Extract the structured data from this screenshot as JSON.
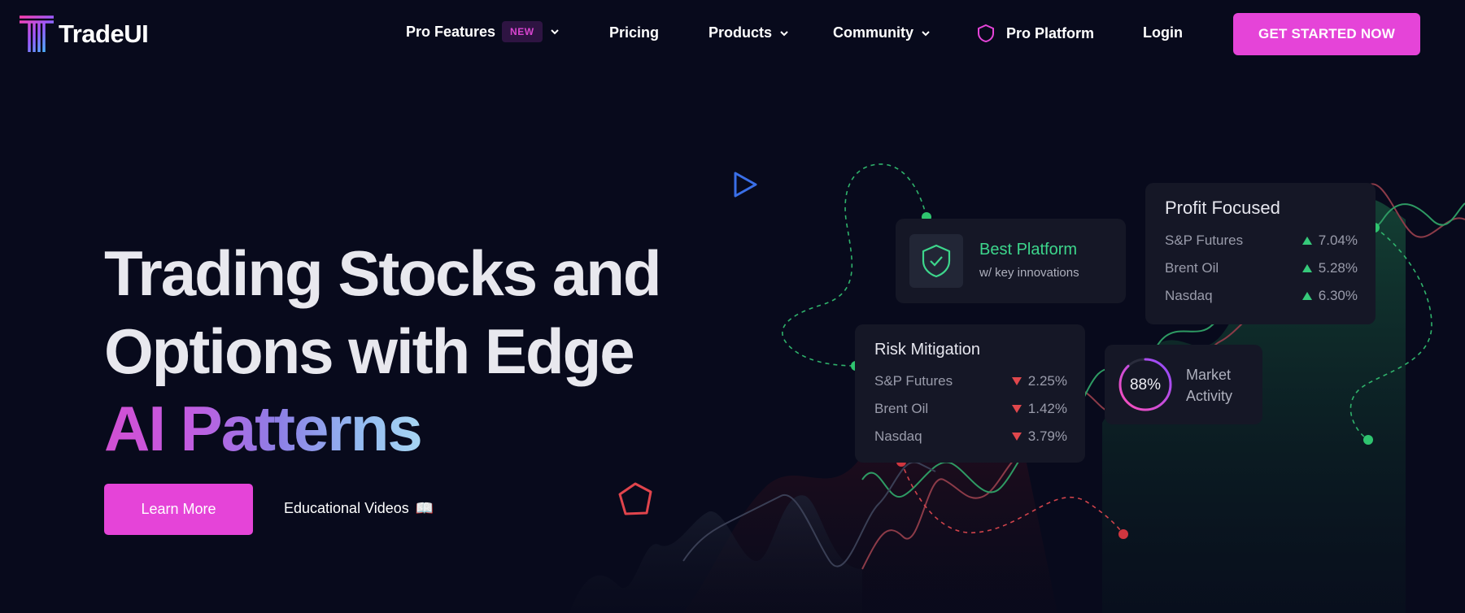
{
  "brand": {
    "name": "TradeUI"
  },
  "nav": {
    "items": [
      {
        "label": "Pro Features",
        "badge": "NEW"
      },
      {
        "label": "Pricing"
      },
      {
        "label": "Products"
      },
      {
        "label": "Community"
      },
      {
        "label": "Pro Platform"
      },
      {
        "label": "Login"
      }
    ],
    "cta": "GET STARTED NOW"
  },
  "hero": {
    "line1": "Trading Stocks and",
    "line2": "Options with Edge",
    "line3": "AI Patterns",
    "primary_button": "Learn More",
    "secondary_link": "Educational Videos",
    "secondary_icon": "📖"
  },
  "cards": {
    "best_platform": {
      "title": "Best Platform",
      "subtitle": "w/ key innovations"
    },
    "profit_focused": {
      "title": "Profit Focused",
      "rows": [
        {
          "name": "S&P Futures",
          "value": "7.04%"
        },
        {
          "name": "Brent Oil",
          "value": "5.28%"
        },
        {
          "name": "Nasdaq",
          "value": "6.30%"
        }
      ]
    },
    "risk_mitigation": {
      "title": "Risk Mitigation",
      "rows": [
        {
          "name": "S&P Futures",
          "value": "2.25%"
        },
        {
          "name": "Brent Oil",
          "value": "1.42%"
        },
        {
          "name": "Nasdaq",
          "value": "3.79%"
        }
      ]
    },
    "market_activity": {
      "percent": "88%",
      "percent_value": 0.88,
      "label_line1": "Market",
      "label_line2": "Activity"
    }
  },
  "colors": {
    "accent": "#e544d8",
    "background": "#080a1c",
    "card": "#151726",
    "up": "#36c97a",
    "down": "#e0474c"
  },
  "icons": {
    "logo": "tradeui-logo-icon",
    "play": "play-icon",
    "pentagon": "pentagon-icon",
    "shield": "shield-icon",
    "shield_check": "shield-check-icon",
    "chevron": "chevron-down-icon",
    "book": "book-icon"
  }
}
